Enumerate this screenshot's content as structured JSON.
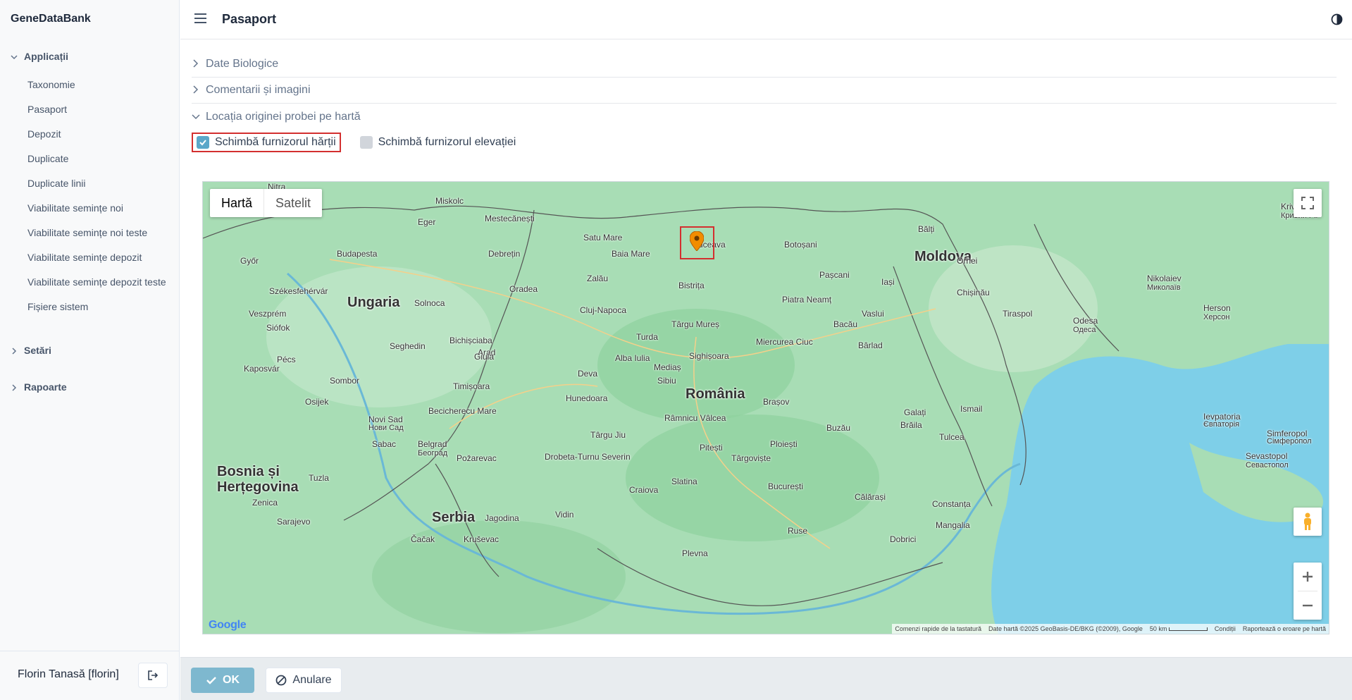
{
  "app": {
    "brand": "GeneDataBank",
    "page_title": "Pasaport"
  },
  "sidebar": {
    "groups": [
      {
        "label": "Applicații",
        "expanded": true
      },
      {
        "label": "Setări",
        "expanded": false
      },
      {
        "label": "Rapoarte",
        "expanded": false
      }
    ],
    "items": [
      {
        "label": "Taxonomie"
      },
      {
        "label": "Pasaport"
      },
      {
        "label": "Depozit"
      },
      {
        "label": "Duplicate"
      },
      {
        "label": "Duplicate linii"
      },
      {
        "label": "Viabilitate semințe noi"
      },
      {
        "label": "Viabilitate semințe noi teste"
      },
      {
        "label": "Viabilitate semințe depozit"
      },
      {
        "label": "Viabilitate semințe depozit teste"
      },
      {
        "label": "Fișiere sistem"
      }
    ],
    "user": "Florin Tanasă [florin]"
  },
  "sections": [
    {
      "label": "Date Biologice",
      "expanded": false
    },
    {
      "label": "Comentarii și imagini",
      "expanded": false
    },
    {
      "label": "Locația originei probei pe hartă",
      "expanded": true
    }
  ],
  "options": {
    "map_provider": {
      "label": "Schimbă furnizorul hărții",
      "checked": true
    },
    "elevation_provider": {
      "label": "Schimbă furnizorul elevației",
      "checked": false
    }
  },
  "map": {
    "type_active": "Hartă",
    "type_inactive": "Satelit",
    "google": "Google",
    "attribution": {
      "shortcuts": "Comenzi rapide de la tastatură",
      "data": "Date hartă ©2025 GeoBasis-DE/BKG (©2009), Google",
      "scale": "50 km",
      "terms": "Condiții",
      "report": "Raportează o eroare pe hartă"
    },
    "countries": {
      "ro": "România",
      "md": "Moldova",
      "hu": "Ungaria",
      "rs": "Serbia",
      "ba1": "Bosnia și",
      "ba2": "Herțegovina"
    },
    "places": {
      "suceava": "Suceava",
      "botosani": "Botoșani",
      "iasi": "Iași",
      "chisinau": "Chișinău",
      "cluj": "Cluj-Napoca",
      "bucuresti": "București",
      "budapesta": "Budapesta",
      "brasov": "Brașov",
      "timisoara": "Timișoara",
      "oradea": "Oradea",
      "satu_mare": "Satu Mare",
      "baia_mare": "Baia Mare",
      "debretin": "Debrețin",
      "piatra": "Piatra Neamț",
      "bacau": "Bacău",
      "galati": "Galați",
      "braila": "Brăila",
      "constanta": "Constanța",
      "odesa": "Odesa",
      "odesa_cyr": "Одеса",
      "tiraspol": "Tiraspol",
      "sibiu": "Sibiu",
      "targu_mures": "Târgu Mureș",
      "arad": "Arad",
      "seghedin": "Seghedin",
      "craiova": "Craiova",
      "pitesti": "Pitești",
      "ploiesti": "Ploiești",
      "buzau": "Buzău",
      "tulcea": "Tulcea",
      "belgrad": "Belgrad",
      "belgrad_cyr": "Београд",
      "sarajevo": "Sarajevo",
      "nikolaiev": "Nikolaiev",
      "nikolaiev_cyr": "Миколаїв",
      "herson": "Herson",
      "herson_cyr": "Херсон",
      "balti": "Bălți",
      "miskolc": "Miskolc",
      "pecs": "Pécs",
      "vaslui": "Vaslui",
      "focsani": "Bârlad",
      "alba": "Alba Iulia",
      "deva": "Deva",
      "ramnicu": "Râmnicu Vâlcea",
      "targu_jiu": "Târgu Jiu",
      "drobeta": "Drobeta-Turnu Severin",
      "slatina": "Slatina",
      "targoviste": "Târgoviște",
      "calarasi": "Călărași",
      "mangalia": "Mangalia",
      "sevastopol": "Sevastopol",
      "sevastopol_cyr": "Севастопол",
      "simferopol": "Simferopol",
      "simferopol_cyr": "Сімферопол",
      "evpatoria": "Ievpatoria",
      "evpatoria_cyr": "Євпаторія",
      "krivii": "Krivii Rih",
      "krivii_cyr": "Кривий Ріг",
      "miercurea": "Miercurea Ciuc",
      "zalau": "Zalău",
      "turda": "Turda",
      "bistrita": "Bistrița",
      "pascani": "Pașcani",
      "novi_sad": "Novi Sad",
      "novi_sad_cyr": "Нови Сад",
      "subotica": "Sombor",
      "osijek": "Osijek",
      "zenica": "Zenica",
      "tuzla": "Tuzla",
      "nitra": "Nitra",
      "gyor": "Győr",
      "szekesfehervar": "Székesfehérvár",
      "veszprem": "Veszprém",
      "siofok": "Siófok",
      "kaposvar": "Kaposvár",
      "solnoca": "Solnoca",
      "eger": "Eger",
      "mestecanesti": "Mestecănești",
      "sighisoara": "Sighișoara",
      "medias": "Mediaș",
      "hunedoara": "Hunedoara",
      "jagodina": "Jagodina",
      "krusevac": "Kruševac",
      "cacak": "Čačak",
      "pozarevac": "Požarevac",
      "vidin": "Vidin",
      "pleven": "Plevna",
      "dobrici": "Dobrici",
      "ruse": "Ruse",
      "ismail": "Ismail",
      "orhei": "Orhei",
      "bicazul": "Bichișciaba",
      "giula": "Giula",
      "becicherecu": "Becicherecu Mare",
      "sabac": "Sabac"
    }
  },
  "footer": {
    "ok": "OK",
    "cancel": "Anulare"
  },
  "colors": {
    "accent": "#5ba7c9",
    "highlight": "#d32f2f",
    "map_land": "#a8ddb5",
    "map_sea": "#7ecfe8"
  }
}
